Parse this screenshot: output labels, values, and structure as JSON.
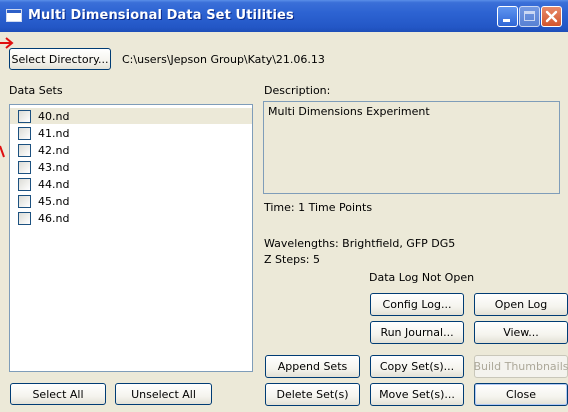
{
  "window": {
    "title": "Multi Dimensional Data Set Utilities"
  },
  "directory": {
    "select_button": "Select Directory...",
    "path": "C:\\users\\Jepson Group\\Katy\\21.06.13"
  },
  "data_sets": {
    "label": "Data Sets",
    "items": [
      {
        "label": "40.nd",
        "checked": false,
        "selected": true
      },
      {
        "label": "41.nd",
        "checked": false,
        "selected": false
      },
      {
        "label": "42.nd",
        "checked": false,
        "selected": false
      },
      {
        "label": "43.nd",
        "checked": false,
        "selected": false
      },
      {
        "label": "44.nd",
        "checked": false,
        "selected": false
      },
      {
        "label": "45.nd",
        "checked": false,
        "selected": false
      },
      {
        "label": "46.nd",
        "checked": false,
        "selected": false
      }
    ],
    "select_all": "Select All",
    "unselect_all": "Unselect All"
  },
  "description": {
    "label": "Description:",
    "text": "Multi Dimensions Experiment"
  },
  "info": {
    "time": "Time: 1 Time Points",
    "wavelengths": "Wavelengths: Brightfield, GFP DG5",
    "z_steps": "Z Steps: 5",
    "data_log_status": "Data Log Not Open"
  },
  "buttons": {
    "config_log": "Config Log...",
    "open_log": "Open Log",
    "run_journal": "Run Journal...",
    "view": "View...",
    "append_sets": "Append Sets",
    "copy_sets": "Copy Set(s)...",
    "build_thumbnails": "Build Thumbnails",
    "delete_sets": "Delete Set(s)",
    "move_sets": "Move Set(s)...",
    "close": "Close"
  },
  "colors": {
    "titlebar": "#2357c6",
    "window_bg": "#ece9d8",
    "annotation": "#e01010"
  }
}
